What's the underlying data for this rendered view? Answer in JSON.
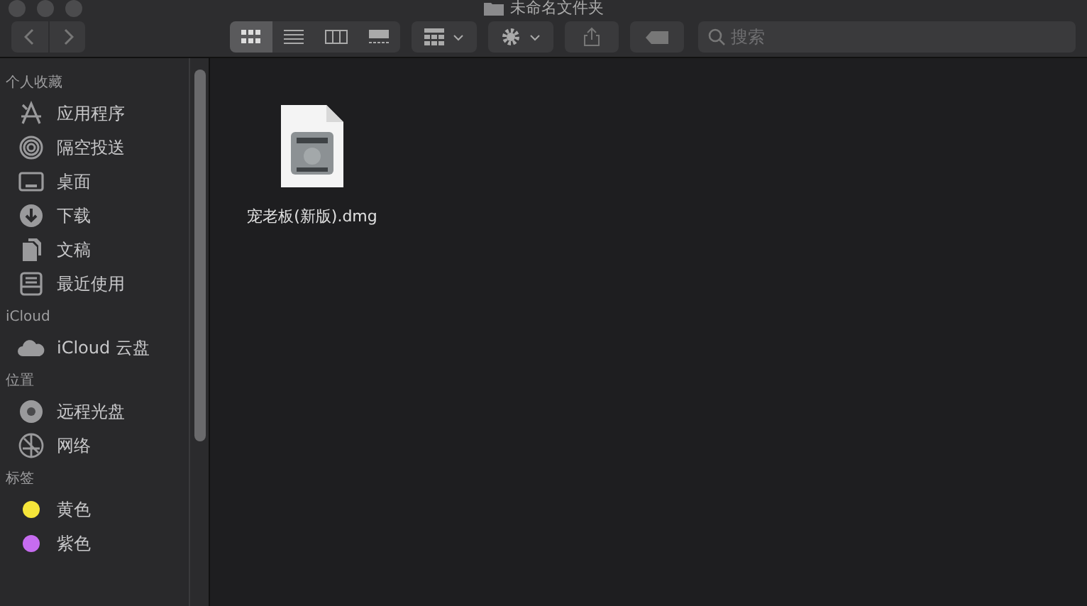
{
  "window": {
    "title": "未命名文件夹"
  },
  "toolbar": {
    "view_modes": [
      {
        "kind": "icons",
        "selected": true
      },
      {
        "kind": "list",
        "selected": false
      },
      {
        "kind": "columns",
        "selected": false
      },
      {
        "kind": "gallery",
        "selected": false
      }
    ],
    "search": {
      "placeholder": "搜索"
    }
  },
  "sidebar": {
    "sections": [
      {
        "title": "个人收藏",
        "items": [
          {
            "kind": "apps",
            "label": "应用程序"
          },
          {
            "kind": "airdrop",
            "label": "隔空投送"
          },
          {
            "kind": "desktop",
            "label": "桌面"
          },
          {
            "kind": "download",
            "label": "下载"
          },
          {
            "kind": "documents",
            "label": "文稿"
          },
          {
            "kind": "recent",
            "label": "最近使用"
          }
        ]
      },
      {
        "title": "iCloud",
        "items": [
          {
            "kind": "cloud",
            "label": "iCloud 云盘"
          }
        ]
      },
      {
        "title": "位置",
        "items": [
          {
            "kind": "disc",
            "label": "远程光盘"
          },
          {
            "kind": "network",
            "label": "网络"
          }
        ]
      },
      {
        "title": "标签",
        "items": [
          {
            "kind": "tag",
            "label": "黄色",
            "color": "#f5e53a"
          },
          {
            "kind": "tag",
            "label": "紫色",
            "color": "#c66cf0"
          }
        ]
      }
    ]
  },
  "files": [
    {
      "name": "宠老板(新版).dmg"
    }
  ]
}
